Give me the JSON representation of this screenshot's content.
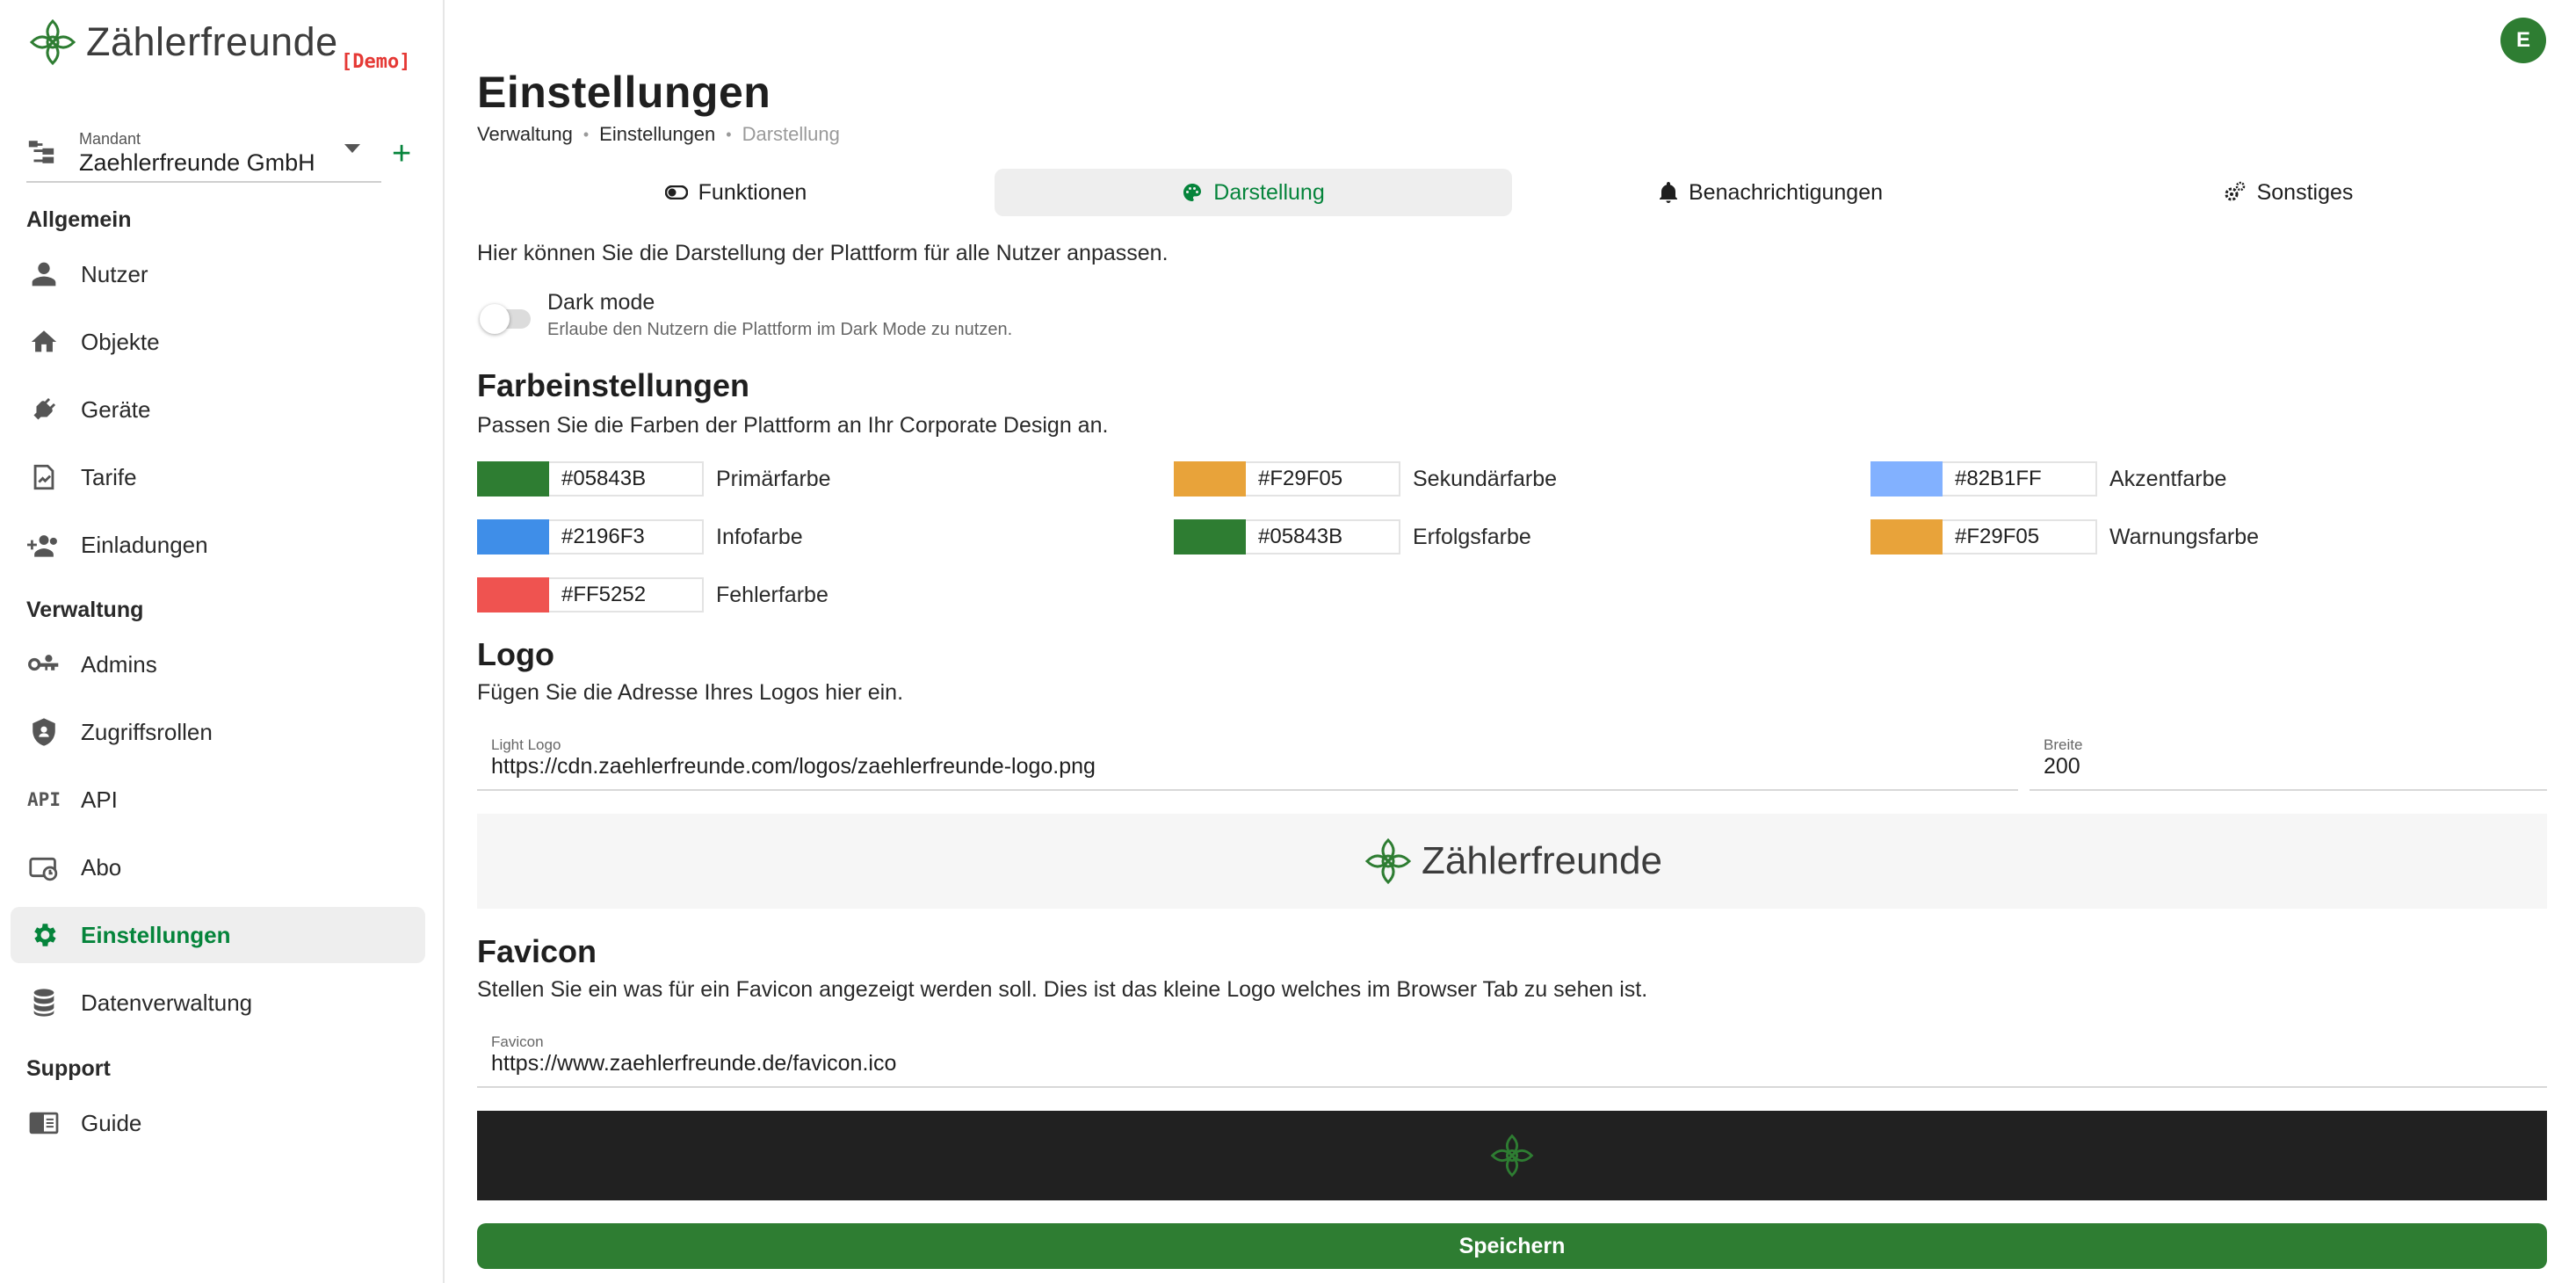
{
  "app": {
    "name": "Zählerfreunde",
    "badge": "[Demo]",
    "user_initial": "E"
  },
  "tenant": {
    "caption": "Mandant",
    "value": "Zaehlerfreunde GmbH"
  },
  "sidebar": {
    "sections": [
      {
        "title": "Allgemein",
        "items": [
          {
            "label": "Nutzer",
            "icon": "person-icon"
          },
          {
            "label": "Objekte",
            "icon": "home-icon"
          },
          {
            "label": "Geräte",
            "icon": "plug-icon"
          },
          {
            "label": "Tarife",
            "icon": "chart-file-icon"
          },
          {
            "label": "Einladungen",
            "icon": "group-add-icon"
          }
        ]
      },
      {
        "title": "Verwaltung",
        "items": [
          {
            "label": "Admins",
            "icon": "key-icon"
          },
          {
            "label": "Zugriffsrollen",
            "icon": "shield-icon"
          },
          {
            "label": "API",
            "icon": "api-icon"
          },
          {
            "label": "Abo",
            "icon": "subscription-icon"
          },
          {
            "label": "Einstellungen",
            "icon": "gear-icon",
            "active": true
          },
          {
            "label": "Datenverwaltung",
            "icon": "database-icon"
          }
        ]
      },
      {
        "title": "Support",
        "items": [
          {
            "label": "Guide",
            "icon": "book-icon"
          }
        ]
      }
    ]
  },
  "page": {
    "title": "Einstellungen",
    "breadcrumb": [
      "Verwaltung",
      "Einstellungen",
      "Darstellung"
    ]
  },
  "tabs": [
    {
      "label": "Funktionen",
      "icon": "toggle-icon"
    },
    {
      "label": "Darstellung",
      "icon": "palette-icon",
      "active": true
    },
    {
      "label": "Benachrichtigungen",
      "icon": "bell-icon"
    },
    {
      "label": "Sonstiges",
      "icon": "gears-icon"
    }
  ],
  "appearance": {
    "intro": "Hier können Sie die Darstellung der Plattform für alle Nutzer anpassen.",
    "dark_mode": {
      "label": "Dark mode",
      "description": "Erlaube den Nutzern die Plattform im Dark Mode zu nutzen.",
      "enabled": false
    }
  },
  "colors": {
    "title": "Farbeinstellungen",
    "description": "Passen Sie die Farben der Plattform an Ihr Corporate Design an.",
    "items": [
      {
        "hex": "#05843B",
        "name": "Primärfarbe",
        "swatch": "#2e7d32"
      },
      {
        "hex": "#F29F05",
        "name": "Sekundärfarbe",
        "swatch": "#e8a33a"
      },
      {
        "hex": "#82B1FF",
        "name": "Akzentfarbe",
        "swatch": "#82b1ff"
      },
      {
        "hex": "#2196F3",
        "name": "Infofarbe",
        "swatch": "#3f8ee8"
      },
      {
        "hex": "#05843B",
        "name": "Erfolgsfarbe",
        "swatch": "#2e7d32"
      },
      {
        "hex": "#F29F05",
        "name": "Warnungsfarbe",
        "swatch": "#e8a33a"
      },
      {
        "hex": "#FF5252",
        "name": "Fehlerfarbe",
        "swatch": "#ef5350"
      }
    ]
  },
  "logo": {
    "title": "Logo",
    "description": "Fügen Sie die Adresse Ihres Logos hier ein.",
    "url_label": "Light Logo",
    "url_value": "https://cdn.zaehlerfreunde.com/logos/zaehlerfreunde-logo.png",
    "width_label": "Breite",
    "width_value": "200",
    "preview_text": "Zählerfreunde"
  },
  "favicon": {
    "title": "Favicon",
    "description": "Stellen Sie ein was für ein Favicon angezeigt werden soll. Dies ist das kleine Logo welches im Browser Tab zu sehen ist.",
    "url_label": "Favicon",
    "url_value": "https://www.zaehlerfreunde.de/favicon.ico"
  },
  "actions": {
    "save_label": "Speichern"
  },
  "theme": {
    "brand": "#05843b",
    "button": "#2e7d32"
  }
}
